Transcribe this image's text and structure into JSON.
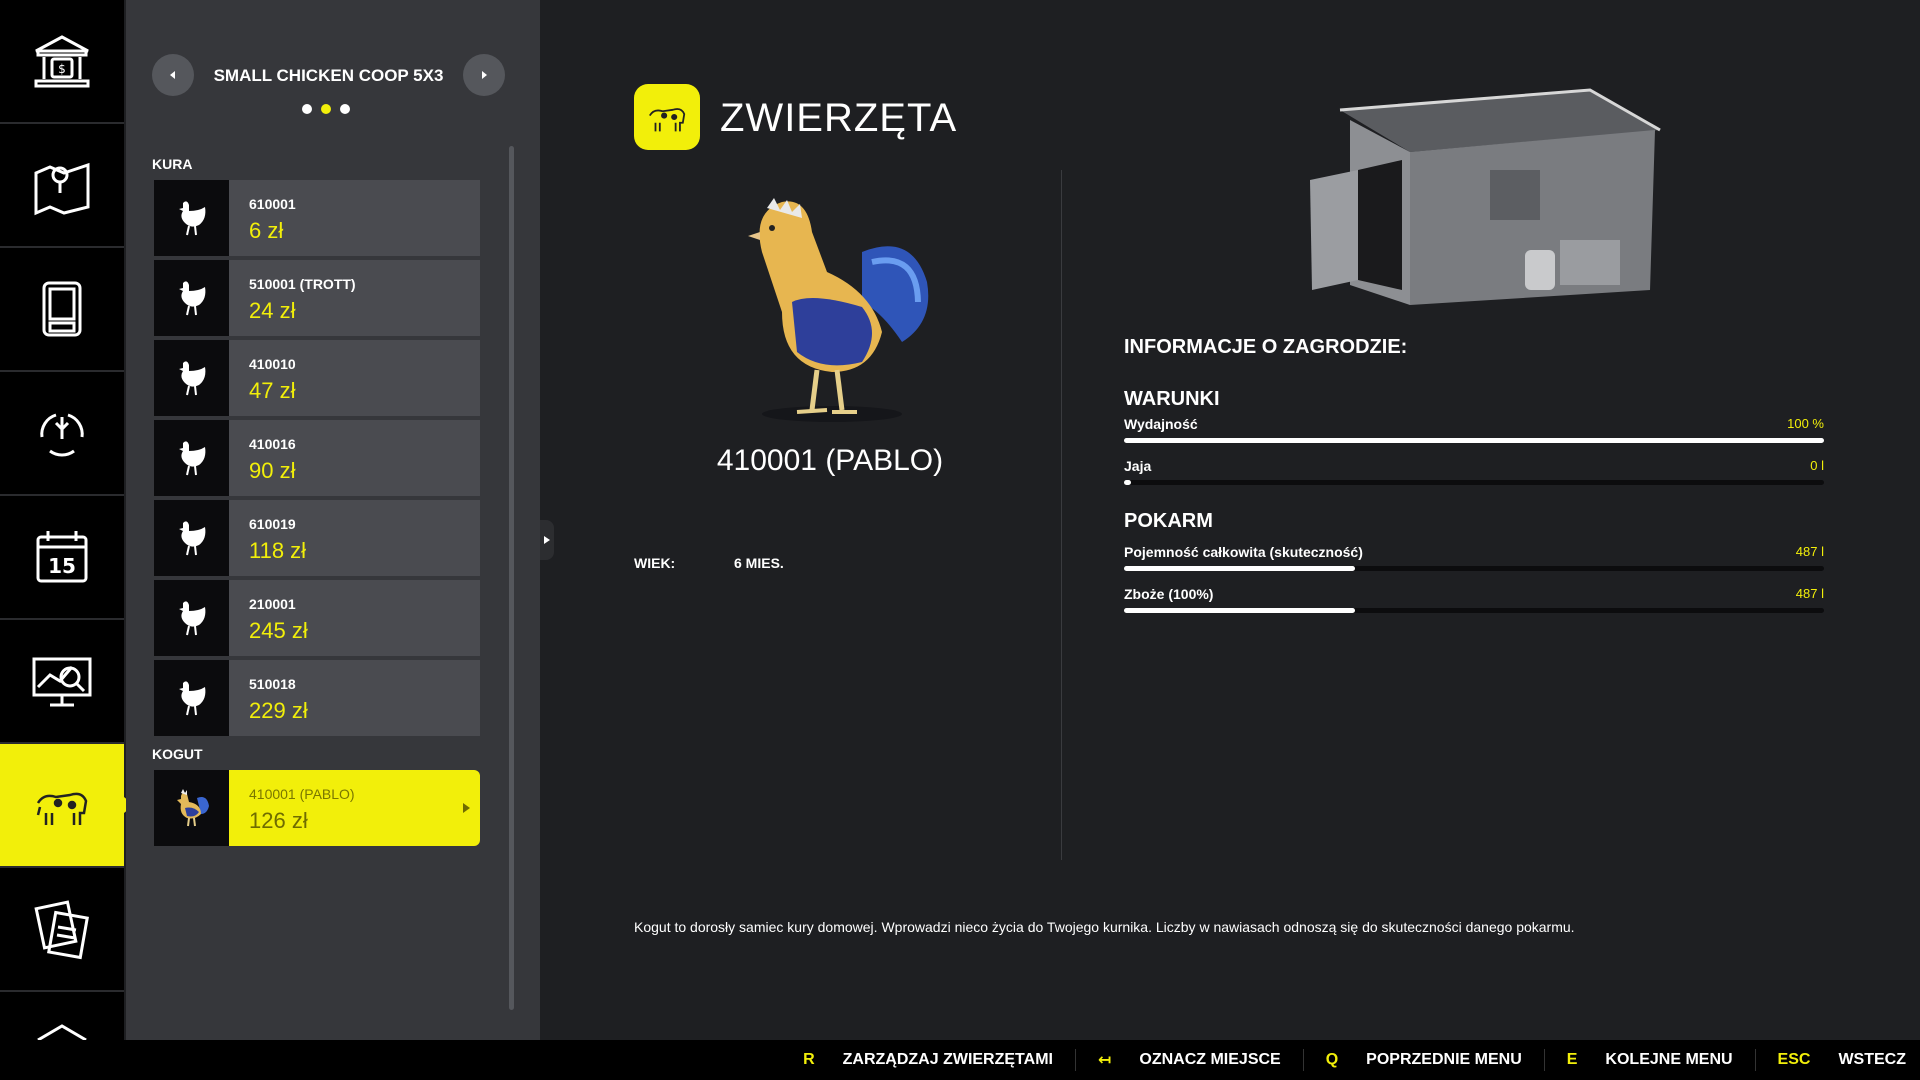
{
  "coop": {
    "title": "SMALL CHICKEN COOP 5X3",
    "page_dots": 3,
    "active_dot": 1
  },
  "groups": {
    "hen_label": "KURA",
    "rooster_label": "KOGUT"
  },
  "hens": [
    {
      "id": "610001",
      "price": "6 zł"
    },
    {
      "id": "510001 (TROTT)",
      "price": "24 zł"
    },
    {
      "id": "410010",
      "price": "47 zł"
    },
    {
      "id": "410016",
      "price": "90 zł"
    },
    {
      "id": "610019",
      "price": "118 zł"
    },
    {
      "id": "210001",
      "price": "245 zł"
    },
    {
      "id": "510018",
      "price": "229 zł"
    }
  ],
  "roosters": [
    {
      "id": "410001 (PABLO)",
      "price": "126 zł",
      "selected": true
    }
  ],
  "rail": {
    "items": [
      "bank-icon",
      "map-icon",
      "gps-icon",
      "production-icon",
      "calendar-icon",
      "statistics-icon",
      "animals-icon",
      "contracts-icon",
      "more-icon"
    ],
    "active_index": 6,
    "calendar_day": "15"
  },
  "main": {
    "title": "ZWIERZĘTA",
    "animal_name": "410001 (PABLO)",
    "age_label": "WIEK:",
    "age_value": "6 MIES.",
    "info_title": "INFORMACJE O ZAGRODZIE:",
    "conditions_title": "WARUNKI",
    "conditions": [
      {
        "label": "Wydajność",
        "value": "100 %",
        "fraction": 1.0
      },
      {
        "label": "Jaja",
        "value": "0 l",
        "fraction": 0.01
      }
    ],
    "food_title": "POKARM",
    "food": [
      {
        "label": "Pojemność całkowita (skuteczność)",
        "value": "487 l",
        "fraction": 0.33
      },
      {
        "label": "Zboże (100%)",
        "value": "487 l",
        "fraction": 0.33
      }
    ],
    "description": "Kogut to dorosły samiec kury domowej. Wprowadzi nieco życia do Twojego kurnika. Liczby w nawiasach odnoszą się do skuteczności danego pokarmu."
  },
  "footer": {
    "hints": [
      {
        "key": "R",
        "label": "ZARZĄDZAJ ZWIERZĘTAMI"
      },
      {
        "key": "↤",
        "label": "OZNACZ MIEJSCE"
      },
      {
        "key": "Q",
        "label": "POPRZEDNIE MENU"
      },
      {
        "key": "E",
        "label": "KOLEJNE MENU"
      },
      {
        "key": "ESC",
        "label": "WSTECZ"
      }
    ]
  },
  "colors": {
    "accent": "#f2ef0a",
    "panel": "#36373b",
    "background": "#1e1f22"
  }
}
